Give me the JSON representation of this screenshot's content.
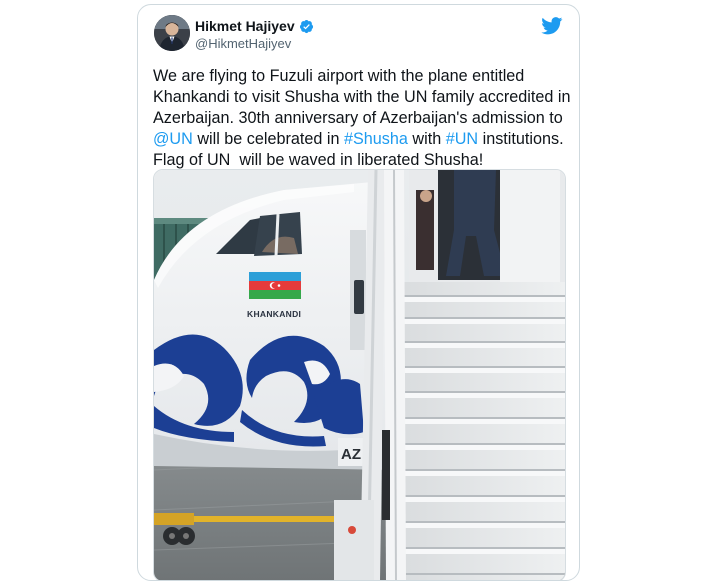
{
  "tweet": {
    "author_name": "Hikmet Hajiyev",
    "author_handle": "@HikmetHajiyev",
    "verified": true,
    "text_parts": [
      "We are flying to Fuzuli airport with the plane entitled Khankandi to visit Shusha with the UN family accredited in Azerbaijan. 30th anniversary of Azerbaijan's admission to ",
      "@UN",
      " will be celebrated in ",
      "#Shusha",
      " with ",
      "#UN",
      " institutions. Flag of UN  will be waved in liberated Shusha!"
    ],
    "image": {
      "plane_name": "KHANKANDI",
      "reg_partial": "AZ"
    }
  },
  "icons": {
    "verified": "verified-badge-icon",
    "brand": "twitter-bird-icon"
  },
  "colors": {
    "link": "#1d9bf0",
    "text": "#0f1419",
    "secondary": "#536471",
    "twitter_blue": "#1d9bf0",
    "livery_blue": "#1c3f94"
  }
}
